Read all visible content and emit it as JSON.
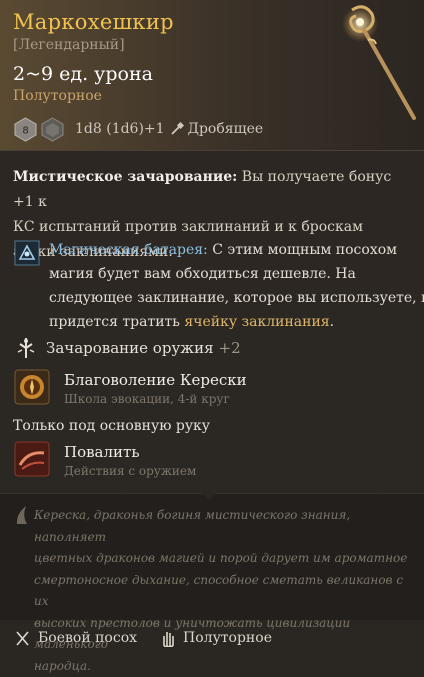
{
  "item": {
    "name": "Маркохешкир",
    "rarity": "[Легендарный]",
    "damage": "2~9 ед. урона",
    "handling": "Полуторное",
    "dice": {
      "die_small_label": "8",
      "formula": "1d8 (1d6)+1",
      "damage_type": "Дробящее"
    }
  },
  "mystic": {
    "title": "Мистическое зачарование:",
    "line1": " Вы получаете бонус +1 к",
    "line2": "КС испытаний против заклинаний и к броскам",
    "line3": "атаки заклинаниями."
  },
  "battery": {
    "name": "Магическая батарея:",
    "line1_rest": " С этим мощным посохом",
    "line2": "магия будет вам обходиться дешевле. На",
    "line3": "следующее заклинание, которое вы используете, не",
    "line4_pre": "придется тратить ",
    "slot": "ячейку заклинания",
    "line4_post": "."
  },
  "enchant": {
    "label": "Зачарование оружия",
    "value": "+2"
  },
  "spells": [
    {
      "name": "Благоволение Керески",
      "desc": "Школа эвокации, 4-й круг"
    }
  ],
  "mainhand": "Только под основную руку",
  "actions": [
    {
      "name": "Повалить",
      "desc": "Действия с оружием"
    }
  ],
  "lore": {
    "line1": "Кереска, драконья богиня мистического знания, наполняет",
    "line2": "цветных драконов магией и порой дарует им ароматное",
    "line3": "смертоносное дыхание, способное сметать великанов с их",
    "line4": "высоких престолов и уничтожать цивилизации маленького",
    "line5": "народца."
  },
  "footer": {
    "type": "Боевой посох",
    "handling": "Полуторное"
  },
  "colors": {
    "title": "#f0c24f",
    "spell_name_blue": "#8fc1e4",
    "spell_slot_gold": "#e0b76a"
  },
  "icons": [
    "staff-icon",
    "die-icon",
    "bludgeoning-icon",
    "magic-battery-icon",
    "weapon-enchant-icon",
    "kereska-favour-icon",
    "topple-icon",
    "lore-icon",
    "staff-type-icon",
    "hand-icon"
  ]
}
